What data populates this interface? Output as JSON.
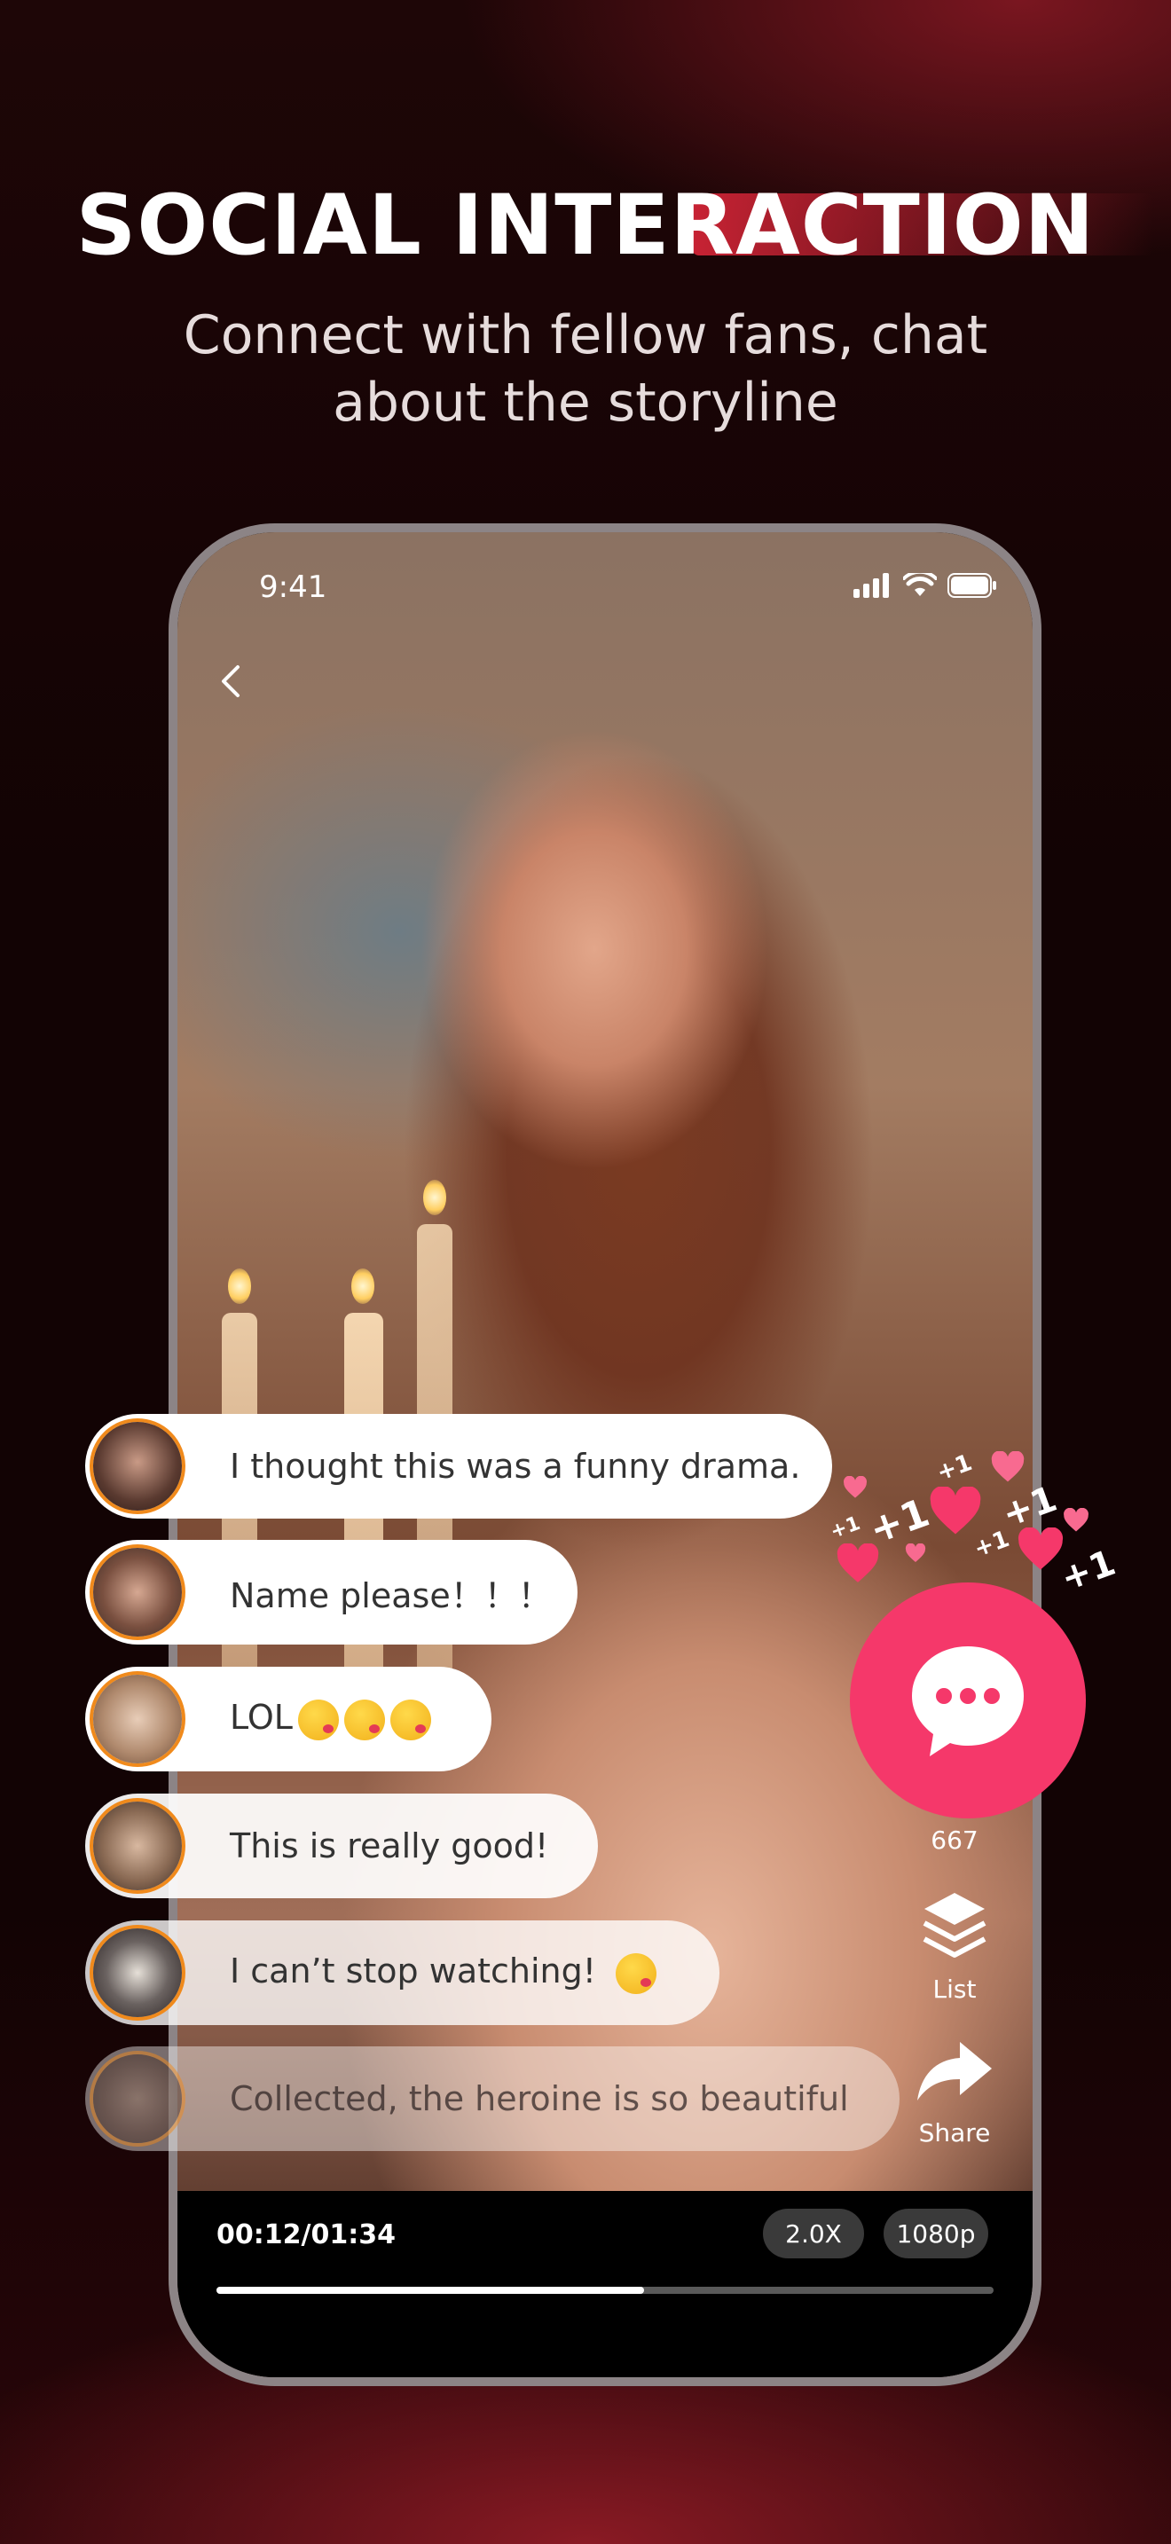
{
  "header": {
    "title": "SOCIAL INTERACTION",
    "subtitle_line1": "Connect with fellow fans, chat",
    "subtitle_line2": "about the storyline"
  },
  "status_bar": {
    "time": "9:41"
  },
  "comments": [
    {
      "text": "I thought this was a funny drama."
    },
    {
      "text": "Name please！！！"
    },
    {
      "text": "LOL"
    },
    {
      "text": "This is really good!"
    },
    {
      "text": "I can’t stop watching!"
    },
    {
      "text": "Collected, the heroine is so beautiful"
    }
  ],
  "actions": {
    "comment_count": "667",
    "list_label": "List",
    "share_label": "Share"
  },
  "reactions": {
    "plus_one": "+1"
  },
  "player": {
    "time": "00:12/01:34",
    "speed": "2.0X",
    "quality": "1080p",
    "progress": 0.55
  },
  "colors": {
    "accent": "#f5386a",
    "avatar_ring": "#f08a1c"
  }
}
